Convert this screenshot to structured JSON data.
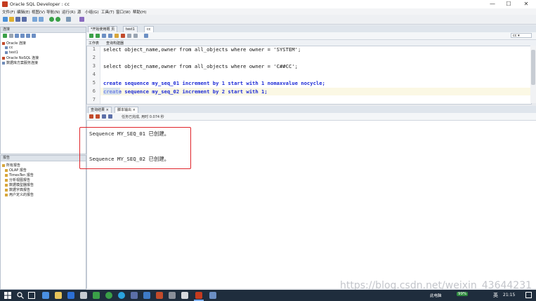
{
  "window": {
    "title": "Oracle SQL Developer : cc",
    "minimize": "—",
    "maximize": "☐",
    "close": "✕"
  },
  "menu": [
    "文件(F)",
    "编辑(E)",
    "视图(V)",
    "导航(N)",
    "运行(R)",
    "源",
    "小组(G)",
    "工具(T)",
    "窗口(W)",
    "帮助(H)"
  ],
  "connections_panel": {
    "header": "连接",
    "items": [
      "Oracle 连接",
      "cc",
      "test1",
      "Oracle NoSQL 连接",
      "数据库方案服务连接"
    ]
  },
  "reports_panel": {
    "header": "报告",
    "items": [
      "所有报告",
      "OLAP 报告",
      "TimesTen 报告",
      "分析视图报告",
      "数据模型器报告",
      "数据字典报告",
      "用户定义的报告"
    ]
  },
  "editor_tabs": [
    "*开始使用概 页",
    "test1",
    "cc"
  ],
  "editor_subtabs": [
    "工作表",
    "查询构建器"
  ],
  "connection_select": "cc",
  "code_lines": [
    {
      "n": "1",
      "text": "select object_name,owner from all_objects where owner = 'SYSTEM';"
    },
    {
      "n": "2",
      "text": ""
    },
    {
      "n": "3",
      "text": "select object_name,owner from all_objects where owner = 'C##CC';"
    },
    {
      "n": "4",
      "text": ""
    },
    {
      "n": "5",
      "text": "create sequence my_seq_01 increment by 1 start with 1 nomaxvalue nocycle;"
    },
    {
      "n": "6",
      "text": "create sequence my_seq_02 increment by 2 start with 1;"
    },
    {
      "n": "7",
      "text": ""
    }
  ],
  "result_tabs": [
    "查询结果",
    "脚本输出"
  ],
  "result_status": "任务已完成, 用时 0.074 秒",
  "output_lines": [
    "Sequence MY_SEQ_01 已创建。",
    "Sequence MY_SEQ_02 已创建。"
  ],
  "taskbar": {
    "lang": "英",
    "time": "21:15",
    "battery": "99%",
    "tray_text": "此电脑"
  },
  "watermark": "https://blog.csdn.net/weixin_43644231"
}
